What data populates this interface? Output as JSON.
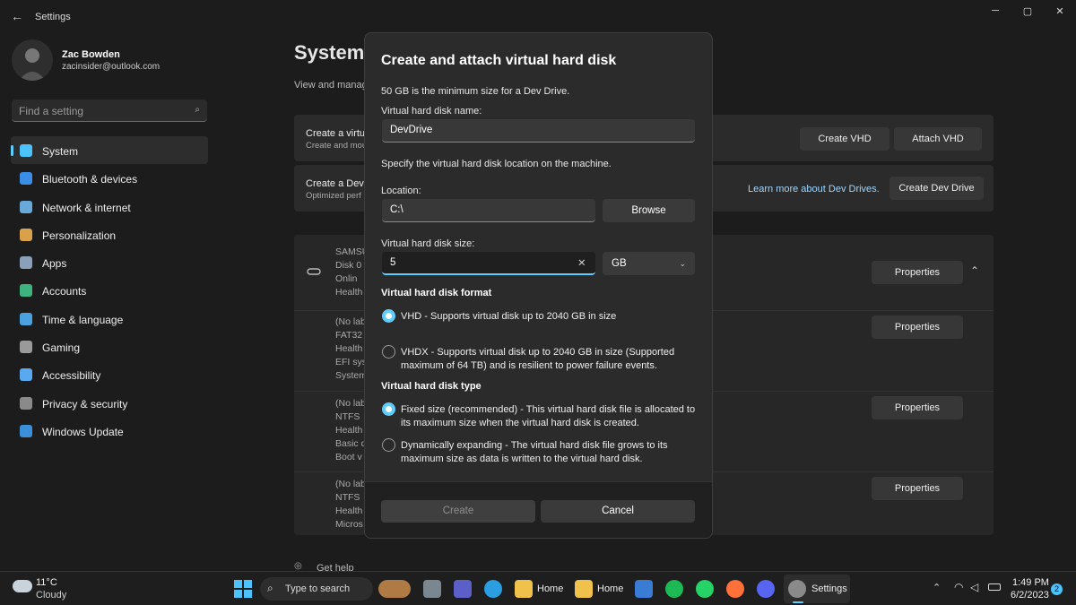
{
  "app": {
    "title": "Settings",
    "back_icon": "back-arrow-icon",
    "minimize": "─",
    "maximize": "▢",
    "close": "✕"
  },
  "user": {
    "name": "Zac Bowden",
    "email": "zacinsider@outlook.com"
  },
  "search": {
    "placeholder": "Find a setting",
    "icon": "search-icon"
  },
  "nav": [
    {
      "label": "System",
      "icon": "system-icon",
      "color": "#4cc2ff",
      "selected": true
    },
    {
      "label": "Bluetooth & devices",
      "icon": "bluetooth-icon",
      "color": "#3a8ee6"
    },
    {
      "label": "Network & internet",
      "icon": "wifi-icon",
      "color": "#69a9d9"
    },
    {
      "label": "Personalization",
      "icon": "brush-icon",
      "color": "#d9a14a"
    },
    {
      "label": "Apps",
      "icon": "apps-icon",
      "color": "#8aa0b8"
    },
    {
      "label": "Accounts",
      "icon": "person-icon",
      "color": "#3fb37f"
    },
    {
      "label": "Time & language",
      "icon": "globe-clock-icon",
      "color": "#4aa3e0"
    },
    {
      "label": "Gaming",
      "icon": "gamepad-icon",
      "color": "#9a9a9a"
    },
    {
      "label": "Accessibility",
      "icon": "accessibility-icon",
      "color": "#5aa9f0"
    },
    {
      "label": "Privacy & security",
      "icon": "shield-icon",
      "color": "#8a8a8a"
    },
    {
      "label": "Windows Update",
      "icon": "update-icon",
      "color": "#3b8fd8"
    }
  ],
  "page": {
    "title": "System",
    "subtitle": "View and manag"
  },
  "background": {
    "vhd": {
      "title": "Create a virtu",
      "sub": "Create and mou",
      "create_btn": "Create VHD",
      "attach_btn": "Attach VHD"
    },
    "devdrive": {
      "title": "Create a Dev",
      "sub": "Optimized perf",
      "link": "Learn more about Dev Drives.",
      "btn": "Create Dev Drive"
    },
    "disk": {
      "lines": [
        "SAMSU",
        "Disk 0",
        "Onlin",
        "Health"
      ],
      "btn": "Properties"
    },
    "p1": {
      "lines": [
        "(No lab",
        "FAT32",
        "Health",
        "EFI sys",
        "System"
      ],
      "btn": "Properties"
    },
    "p2": {
      "lines": [
        "(No lab",
        "NTFS",
        "Health",
        "Basic d",
        "Boot v"
      ],
      "btn": "Properties"
    },
    "p3": {
      "lines": [
        "(No lab",
        "NTFS",
        "Health",
        "Micros"
      ],
      "btn": "Properties"
    },
    "help": "Get help"
  },
  "dialog": {
    "title": "Create and attach virtual hard disk",
    "min_note": "50 GB is the minimum size for a Dev Drive.",
    "name_label": "Virtual hard disk name:",
    "name_value": "DevDrive",
    "location_note": "Specify the virtual hard disk location on the machine.",
    "location_label": "Location:",
    "location_value": "C:\\",
    "browse": "Browse",
    "size_label": "Virtual hard disk size:",
    "size_value": "5",
    "unit": "GB",
    "format_heading": "Virtual hard disk format",
    "vhd_option": "VHD - Supports virtual disk up to 2040 GB in size",
    "vhdx_option": "VHDX - Supports virtual disk up to 2040 GB in size (Supported maximum of 64 TB) and is resilient to power failure events.",
    "type_heading": "Virtual hard disk type",
    "fixed_option": "Fixed size (recommended) - This virtual hard disk file is allocated to its maximum size when the virtual hard disk is created.",
    "dynamic_option": "Dynamically expanding - The virtual hard disk file grows to its maximum size as data is written to the virtual hard disk.",
    "create": "Create",
    "cancel": "Cancel"
  },
  "taskbar": {
    "weather_temp": "11°C",
    "weather_desc": "Cloudy",
    "search_text": "Type to search",
    "explorer1": "Home",
    "explorer2": "Home",
    "settings": "Settings",
    "time": "1:49 PM",
    "date": "6/2/2023",
    "notifications": "2"
  }
}
